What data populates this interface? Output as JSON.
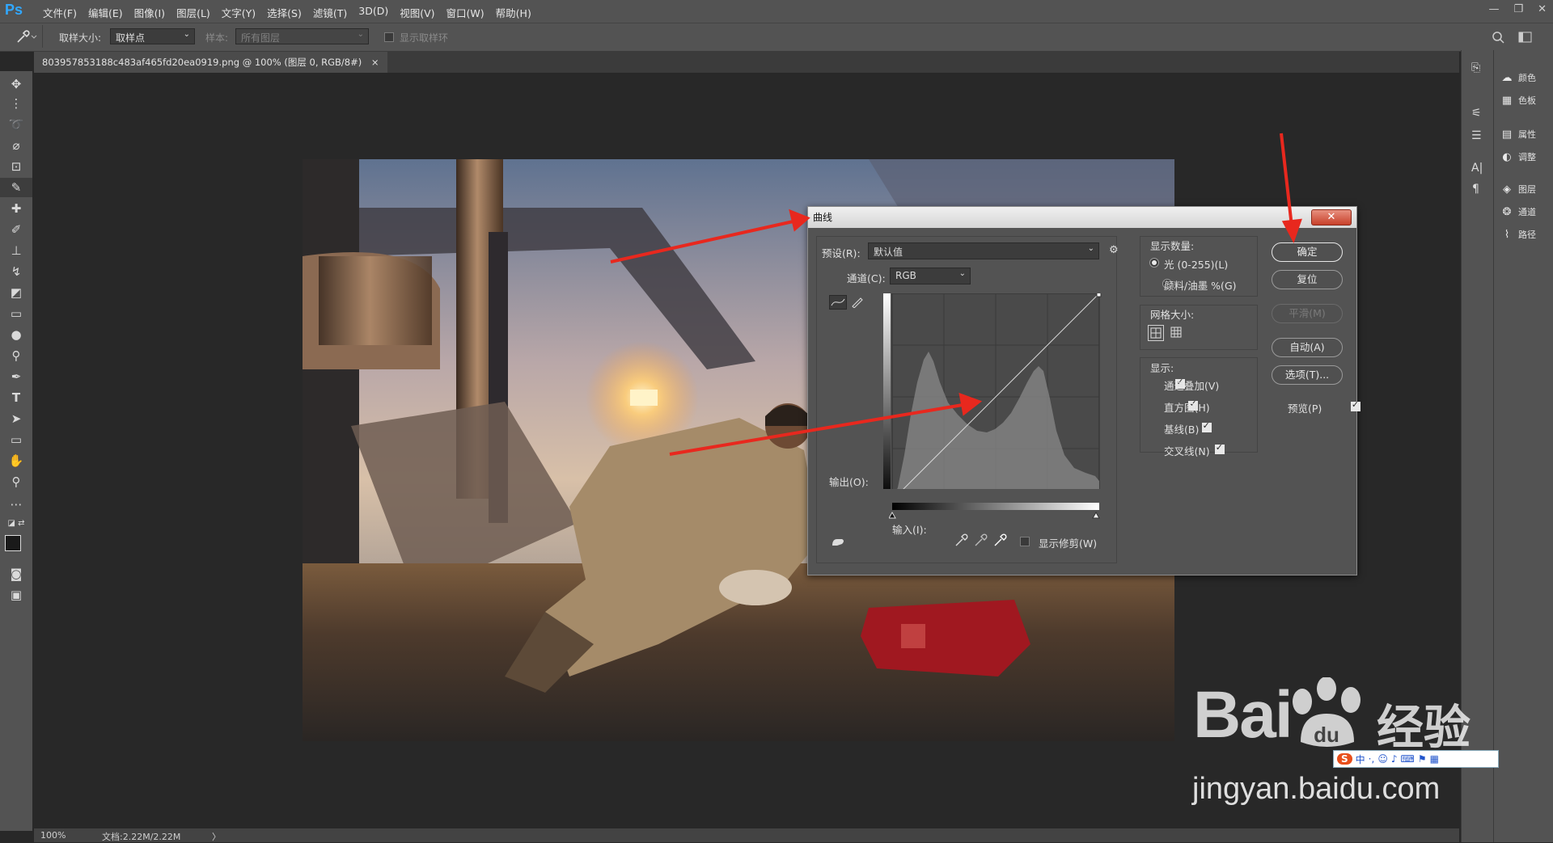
{
  "app": {
    "logo": "Ps"
  },
  "menu": [
    "文件(F)",
    "编辑(E)",
    "图像(I)",
    "图层(L)",
    "文字(Y)",
    "选择(S)",
    "滤镜(T)",
    "3D(D)",
    "视图(V)",
    "窗口(W)",
    "帮助(H)"
  ],
  "window_controls": {
    "minimize": "—",
    "restore": "❐",
    "close": "✕"
  },
  "options": {
    "sample_size_label": "取样大小:",
    "sample_size_value": "取样点",
    "sample_label": "样本:",
    "sample_value": "所有图层",
    "show_ring_label": "显示取样环"
  },
  "document": {
    "tab_title": "803957853188c483af465fd20ea0919.png @ 100% (图层 0, RGB/8#)",
    "tab_close": "×"
  },
  "status": {
    "zoom": "100%",
    "doc_info": "文档:2.22M/2.22M",
    "arrow": "〉"
  },
  "right_panels": [
    {
      "icon": "palette-icon",
      "label": "颜色"
    },
    {
      "icon": "swatches-icon",
      "label": "色板"
    },
    {
      "icon": "properties-icon",
      "label": "属性"
    },
    {
      "icon": "adjustments-icon",
      "label": "调整"
    },
    {
      "icon": "layers-icon",
      "label": "图层"
    },
    {
      "icon": "channels-icon",
      "label": "通道"
    },
    {
      "icon": "paths-icon",
      "label": "路径"
    }
  ],
  "dialog": {
    "title": "曲线",
    "close_glyph": "✕",
    "preset_label": "预设(R):",
    "preset_value": "默认值",
    "channel_label": "通道(C):",
    "channel_value": "RGB",
    "output_label": "输出(O):",
    "input_label": "输入(I):",
    "show_clipping_label": "显示修剪(W)",
    "display_amount": {
      "title": "显示数量:",
      "options": [
        {
          "label": "光 (0-255)(L)",
          "selected": true
        },
        {
          "label": "颜料/油墨 %(G)",
          "selected": false
        }
      ]
    },
    "grid_size_title": "网格大小:",
    "show": {
      "title": "显示:",
      "options": [
        {
          "label": "通道叠加(V)",
          "checked": true
        },
        {
          "label": "直方图(H)",
          "checked": true
        },
        {
          "label": "基线(B)",
          "checked": true
        },
        {
          "label": "交叉线(N)",
          "checked": true
        }
      ]
    },
    "buttons": {
      "ok": "确定",
      "reset": "复位",
      "smooth": "平滑(M)",
      "auto": "自动(A)",
      "options": "选项(T)..."
    },
    "preview_label": "预览(P)",
    "preview_checked": true
  },
  "watermark": {
    "brand": "Bai",
    "brand_suffix": "经验",
    "url": "jingyan.baidu.com",
    "ime_text": "中"
  },
  "colors": {
    "ps_blue": "#31a8ff",
    "panel_bg": "#535353",
    "canvas_bg": "#282828",
    "arrow_red": "#e8281e"
  }
}
